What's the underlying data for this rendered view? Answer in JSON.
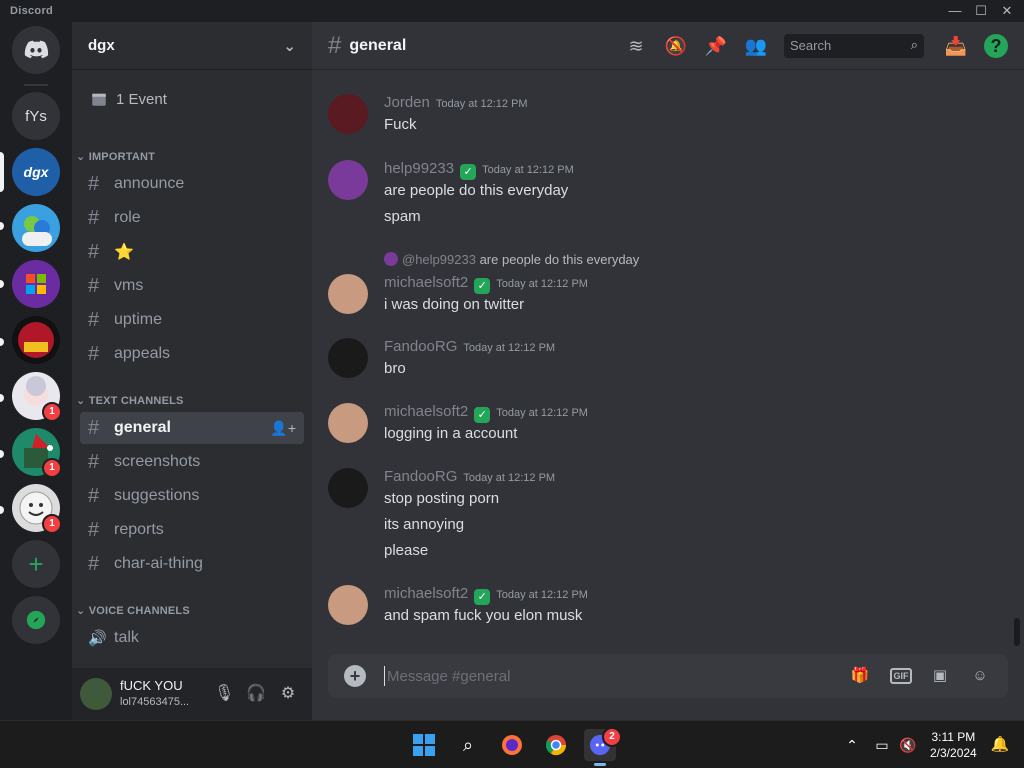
{
  "window": {
    "app_name": "Discord",
    "minimize_glyph": "—",
    "maximize_glyph": "☐",
    "close_glyph": "✕"
  },
  "guilds": [
    {
      "name": "discord-home",
      "label": "",
      "icon": "discord-logo-icon",
      "color": "#313338"
    },
    {
      "name": "fYs",
      "label": "fYs",
      "color": "#313338"
    },
    {
      "name": "dgx",
      "label": "dgx",
      "color": "#1f5fa8",
      "selected": true
    },
    {
      "name": "messenger",
      "label": "",
      "color": "#3aa0e0"
    },
    {
      "name": "windows",
      "label": "",
      "color": "#6a2ca0"
    },
    {
      "name": "guild-red",
      "label": "",
      "color": "#b0182a"
    },
    {
      "name": "guild-anime",
      "label": "",
      "color": "#e8e8ee",
      "badge": "1"
    },
    {
      "name": "guild-xmas",
      "label": "",
      "color": "#1e8a6a",
      "badge": "1"
    },
    {
      "name": "guild-smiley",
      "label": "",
      "color": "#dcdcdc",
      "badge": "1"
    }
  ],
  "server": {
    "name": "dgx",
    "event_label": "1 Event"
  },
  "categories": {
    "important": "IMPORTANT",
    "text": "TEXT CHANNELS",
    "voice": "VOICE CHANNELS"
  },
  "important_channels": [
    "announce",
    "role",
    "⭐",
    "vms",
    "uptime",
    "appeals"
  ],
  "text_channels": [
    "general",
    "screenshots",
    "suggestions",
    "reports",
    "char-ai-thing"
  ],
  "voice_channels": [
    "talk"
  ],
  "active_channel": "general",
  "user": {
    "name": "fUCK YOU",
    "tag": "lol74563475..."
  },
  "header": {
    "channel": "general",
    "search_placeholder": "Search"
  },
  "messages": [
    {
      "author": "Jorden",
      "time": "Today at 12:12 PM",
      "lines": [
        "Fuck"
      ],
      "avatar_color": "#5a1a22"
    },
    {
      "author": "help99233",
      "time": "Today at 12:12 PM",
      "lines": [
        "are people do this everyday",
        "spam"
      ],
      "verified": true,
      "avatar_color": "#7a3a9a"
    },
    {
      "author": "michaelsoft2",
      "time": "Today at 12:12 PM",
      "lines": [
        "i was doing on twitter"
      ],
      "verified": true,
      "avatar_color": "#c89a80",
      "reply": {
        "name": "@help99233",
        "text": "are people do this everyday"
      }
    },
    {
      "author": "FandooRG",
      "time": "Today at 12:12 PM",
      "lines": [
        "bro"
      ],
      "avatar_color": "#1a1a1a"
    },
    {
      "author": "michaelsoft2",
      "time": "Today at 12:12 PM",
      "lines": [
        "logging in a account"
      ],
      "verified": true,
      "avatar_color": "#c89a80"
    },
    {
      "author": "FandooRG",
      "time": "Today at 12:12 PM",
      "lines": [
        "stop posting porn",
        "its annoying",
        "please"
      ],
      "avatar_color": "#1a1a1a"
    },
    {
      "author": "michaelsoft2",
      "time": "Today at 12:12 PM",
      "lines": [
        "and spam fuck you elon musk"
      ],
      "verified": true,
      "avatar_color": "#c89a80"
    }
  ],
  "composer": {
    "placeholder": "Message #general",
    "gif_label": "GIF"
  },
  "taskbar": {
    "time": "3:11 PM",
    "date": "2/3/2024",
    "discord_badge": "2"
  }
}
